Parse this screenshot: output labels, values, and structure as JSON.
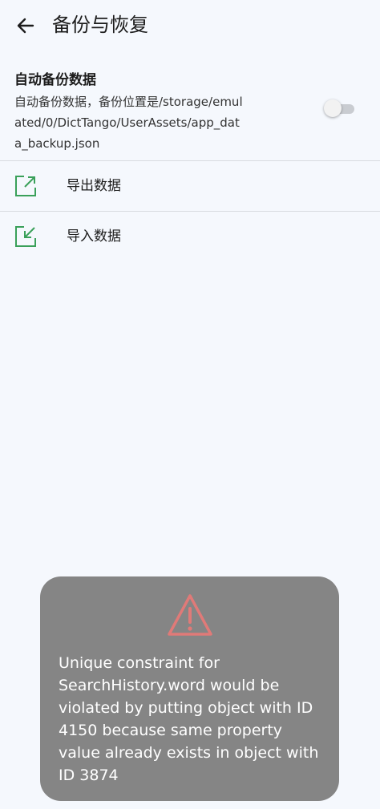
{
  "header": {
    "title": "备份与恢复"
  },
  "auto_backup": {
    "title": "自动备份数据",
    "description": "自动备份数据，备份位置是/storage/emulated/0/DictTango/UserAssets/app_data_backup.json",
    "enabled": false
  },
  "actions": {
    "export_label": "导出数据",
    "import_label": "导入数据"
  },
  "toast": {
    "icon": "warning-icon",
    "message": "Unique constraint for SearchHistory.word would be violated by putting object with ID 4150 because same property value already exists in object with ID 3874"
  },
  "colors": {
    "background": "#f5f8fd",
    "icon_green": "#3aa05a",
    "warning_red": "#e07a78",
    "toast_bg": "#858585"
  }
}
